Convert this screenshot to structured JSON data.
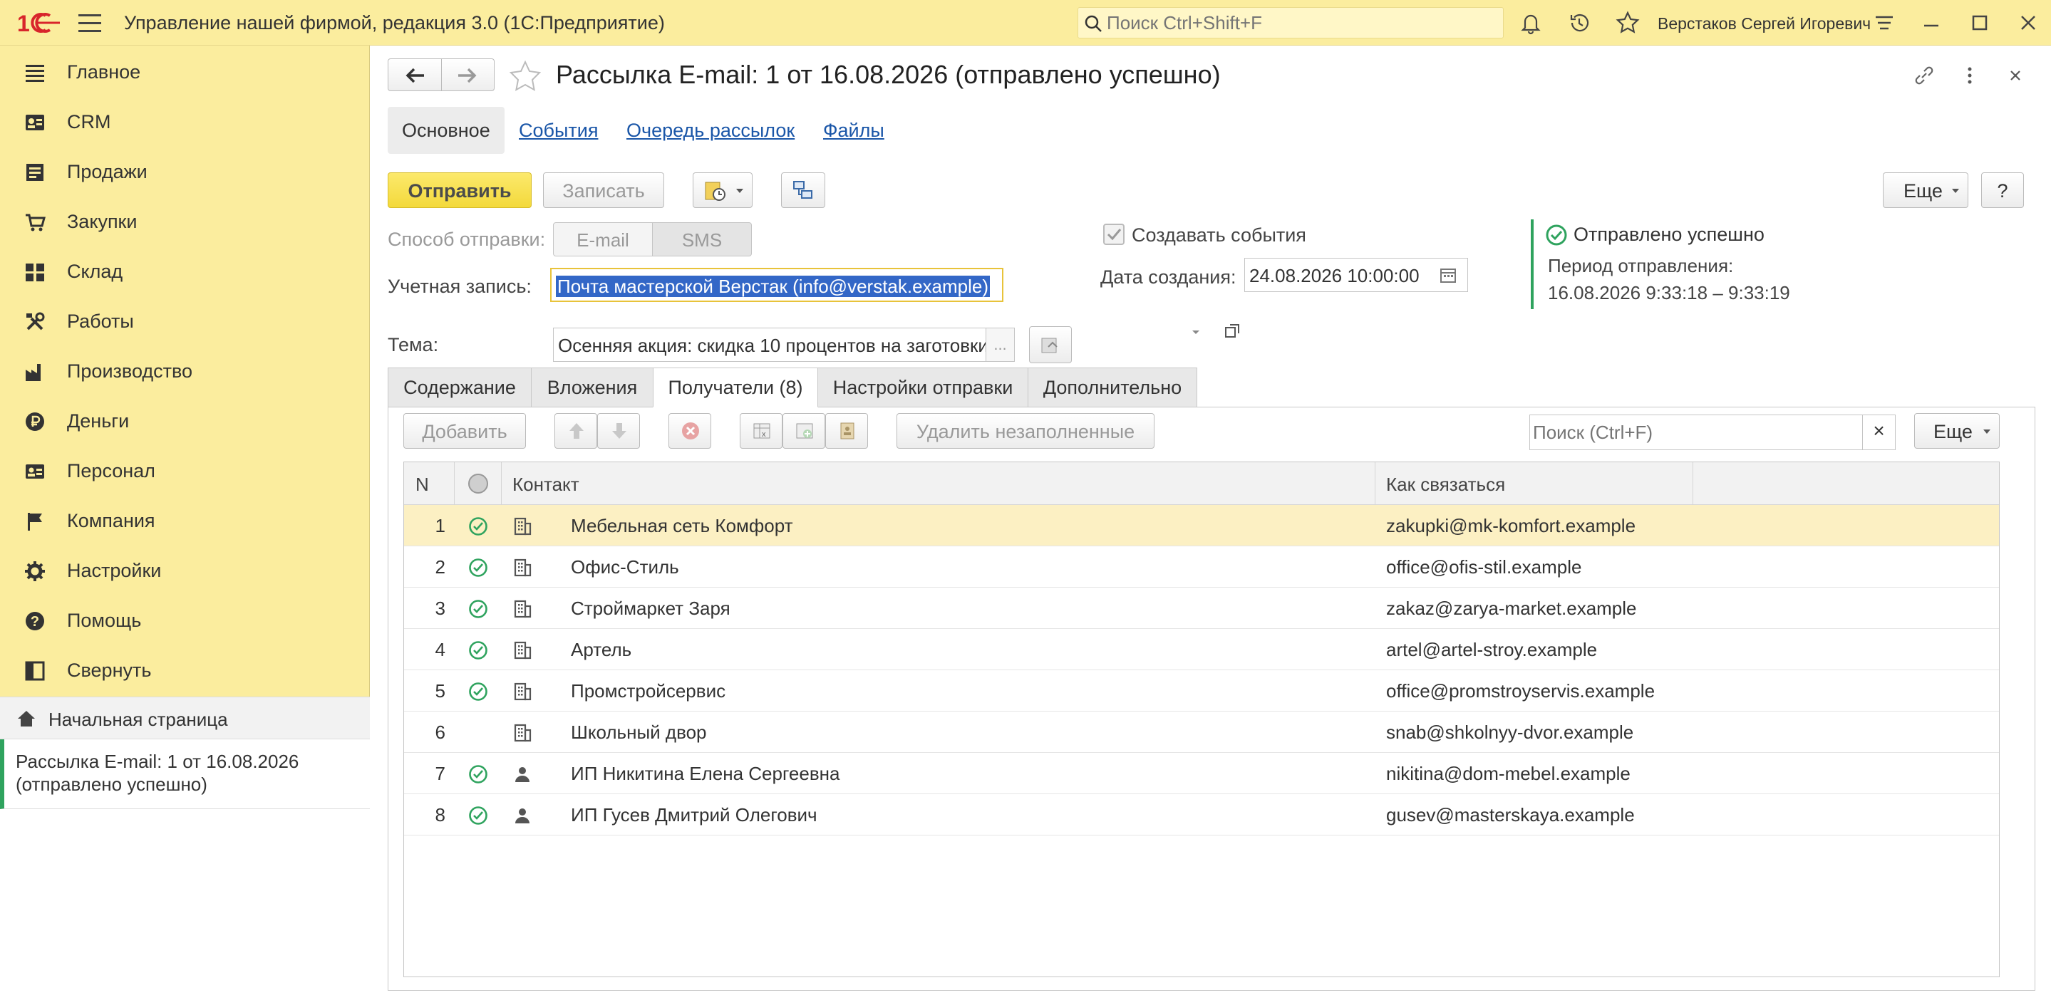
{
  "app": {
    "title": "Управление нашей фирмой, редакция 3.0  (1С:Предприятие)",
    "search_placeholder": "Поиск Ctrl+Shift+F",
    "user": "Верстаков Сергей Игоревич"
  },
  "sidebar": {
    "items": [
      {
        "label": "Главное",
        "icon": "menu-lines-icon"
      },
      {
        "label": "CRM",
        "icon": "contact-card-icon"
      },
      {
        "label": "Продажи",
        "icon": "sales-icon"
      },
      {
        "label": "Закупки",
        "icon": "cart-icon"
      },
      {
        "label": "Склад",
        "icon": "warehouse-grid-icon"
      },
      {
        "label": "Работы",
        "icon": "tools-icon"
      },
      {
        "label": "Производство",
        "icon": "factory-icon"
      },
      {
        "label": "Деньги",
        "icon": "ruble-coin-icon"
      },
      {
        "label": "Персонал",
        "icon": "staff-icon"
      },
      {
        "label": "Компания",
        "icon": "flag-icon"
      },
      {
        "label": "Настройки",
        "icon": "gear-icon"
      },
      {
        "label": "Помощь",
        "icon": "question-circle-icon"
      },
      {
        "label": "Свернуть",
        "icon": "collapse-panel-icon"
      }
    ],
    "home": "Начальная страница",
    "open_document": "Рассылка E-mail: 1 от 16.08.2026 (отправлено успешно)"
  },
  "document": {
    "title": "Рассылка E-mail: 1 от 16.08.2026 (отправлено успешно)",
    "tabs": {
      "main": "Основное",
      "events": "События",
      "queue": "Очередь рассылок",
      "files": "Файлы"
    },
    "toolbar": {
      "send": "Отправить",
      "save": "Записать",
      "more": "Еще",
      "help": "?"
    },
    "form": {
      "method_label": "Способ отправки:",
      "method_options": [
        "E-mail",
        "SMS"
      ],
      "account_label": "Учетная запись:",
      "account_value": "Почта мастерской Верстак (info@verstak.example)",
      "subject_label": "Тема:",
      "subject_value": "Осенняя акция: скидка 10 процентов на заготовки",
      "subject_more": "...",
      "create_events_label": "Создавать события",
      "created_label": "Дата создания:",
      "created_value": "24.08.2026 10:00:00"
    },
    "status": {
      "text": "Отправлено успешно",
      "period_label": "Период отправления:",
      "period_value": "16.08.2026 9:33:18 – 9:33:19"
    },
    "inner_tabs": [
      "Содержание",
      "Вложения",
      "Получатели (8)",
      "Настройки отправки",
      "Дополнительно"
    ],
    "recipients_toolbar": {
      "add": "Добавить",
      "delete_empty": "Удалить незаполненные",
      "search_placeholder": "Поиск (Ctrl+F)",
      "search_clear": "×",
      "more": "Еще"
    },
    "table": {
      "headers": {
        "n": "N",
        "contact": "Контакт",
        "how": "Как связаться"
      },
      "rows": [
        {
          "n": "1",
          "sent": true,
          "type": "organization-icon",
          "name": "Мебельная сеть Комфорт",
          "email": "zakupki@mk-komfort.example"
        },
        {
          "n": "2",
          "sent": true,
          "type": "organization-icon",
          "name": "Офис-Стиль",
          "email": "office@ofis-stil.example"
        },
        {
          "n": "3",
          "sent": true,
          "type": "organization-icon",
          "name": "Строймаркет Заря",
          "email": "zakaz@zarya-market.example"
        },
        {
          "n": "4",
          "sent": true,
          "type": "organization-icon",
          "name": "Артель",
          "email": "artel@artel-stroy.example"
        },
        {
          "n": "5",
          "sent": true,
          "type": "organization-icon",
          "name": "Промстройсервис",
          "email": "office@promstroyservis.example"
        },
        {
          "n": "6",
          "sent": false,
          "type": "organization-icon",
          "name": "Школьный двор",
          "email": "snab@shkolnyy-dvor.example"
        },
        {
          "n": "7",
          "sent": true,
          "type": "person-icon",
          "name": "ИП Никитина Елена Сергеевна",
          "email": "nikitina@dom-mebel.example"
        },
        {
          "n": "8",
          "sent": true,
          "type": "person-icon",
          "name": "ИП Гусев Дмитрий Олегович",
          "email": "gusev@masterskaya.example"
        }
      ]
    }
  },
  "colors": {
    "chrome_yellow": "#fbed9e",
    "accent_green": "#2fa35e",
    "link_blue": "#1a56a8",
    "current_row": "#fcf0c3",
    "logo_red": "#d8252b"
  }
}
